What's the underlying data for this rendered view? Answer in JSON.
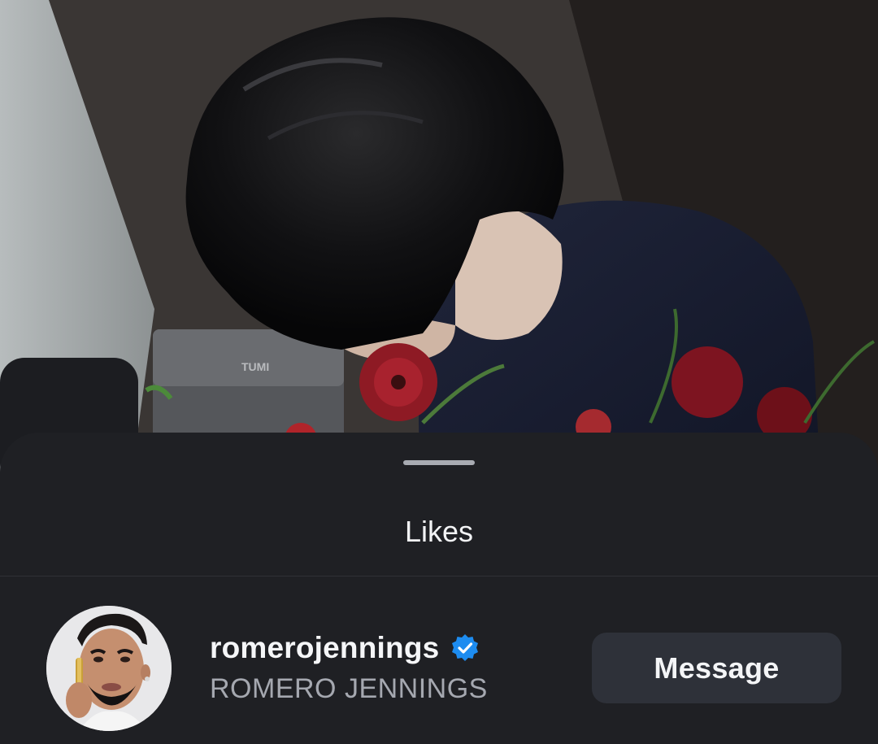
{
  "sheet": {
    "title": "Likes"
  },
  "likes": [
    {
      "username": "romerojennings",
      "verified": true,
      "full_name": "ROMERO JENNINGS",
      "action_label": "Message"
    }
  ],
  "colors": {
    "sheet_background": "#1f2024",
    "button_background": "#2e3139",
    "verified_badge": "#1d8cf0",
    "secondary_text": "#a5a8b0"
  },
  "icons": {
    "verified": "verified-badge-icon"
  }
}
